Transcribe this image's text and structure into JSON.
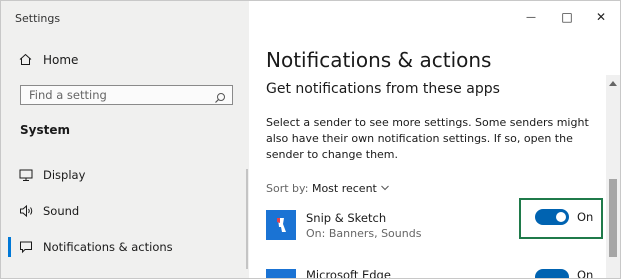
{
  "window": {
    "title": "Settings",
    "minimize_glyph": "—",
    "maximize_glyph": "□",
    "close_glyph": "✕"
  },
  "sidebar": {
    "home_label": "Home",
    "search_placeholder": "Find a setting",
    "section_label": "System",
    "items": [
      {
        "label": "Display",
        "icon": "monitor-icon"
      },
      {
        "label": "Sound",
        "icon": "speaker-icon"
      },
      {
        "label": "Notifications & actions",
        "icon": "notification-icon",
        "active": true
      }
    ]
  },
  "main": {
    "title": "Notifications & actions",
    "subtitle": "Get notifications from these apps",
    "description": "Select a sender to see more settings. Some senders might also have their own notification settings. If so, open the sender to change them.",
    "sort_label": "Sort by:",
    "sort_value": "Most recent",
    "apps": [
      {
        "name": "Snip & Sketch",
        "detail": "On: Banners, Sounds",
        "toggle_state": "On"
      },
      {
        "name": "Microsoft Edge",
        "toggle_state": "On"
      }
    ]
  },
  "colors": {
    "accent": "#0078d7",
    "toggle_on": "#0063b1",
    "highlight_border": "#1f7a4a",
    "sidebar_bg": "#f0f0ef"
  }
}
